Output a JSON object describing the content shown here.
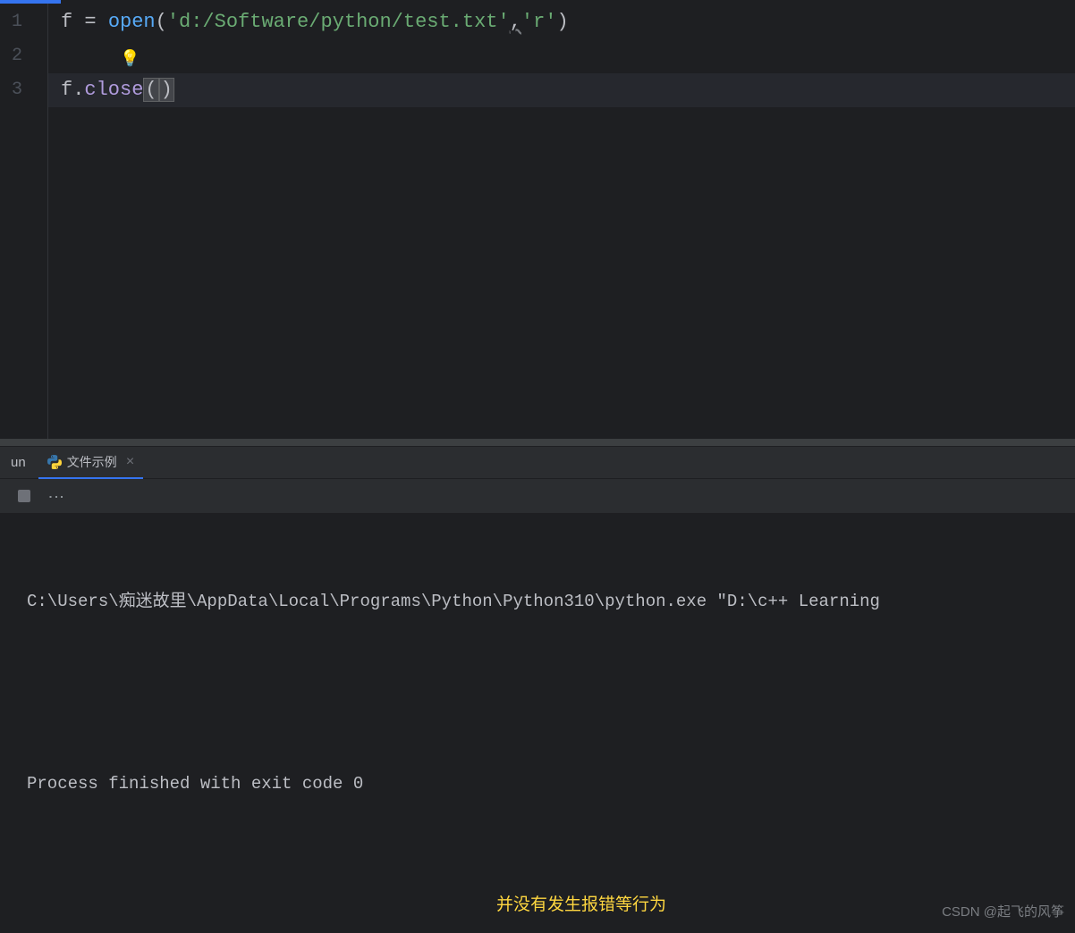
{
  "editor": {
    "lines": [
      "1",
      "2",
      "3"
    ],
    "code": {
      "line1": {
        "var": "f",
        "op": " = ",
        "builtin": "open",
        "paren_open": "(",
        "string1": "'d:/Software/python/test.txt'",
        "comma": ",",
        "string2": "'r'",
        "paren_close": ")"
      },
      "line3": {
        "var": "f",
        "dot": ".",
        "method": "close",
        "paren_open": "(",
        "paren_close": ")"
      }
    },
    "bulb": "💡"
  },
  "panel": {
    "label": "un",
    "tab_name": "文件示例",
    "tab_close": "×"
  },
  "console": {
    "line1": "C:\\Users\\痴迷故里\\AppData\\Local\\Programs\\Python\\Python310\\python.exe \"D:\\c++ Learning",
    "line3": "Process finished with exit code 0"
  },
  "annotation": "并没有发生报错等行为",
  "watermark": "CSDN @起飞的风筝"
}
